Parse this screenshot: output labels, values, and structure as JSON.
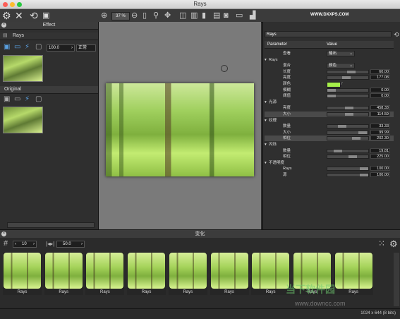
{
  "window": {
    "title": "Rays"
  },
  "toolbar": {
    "zoom": "37 %",
    "brand": "WWW.DXXPS.COM"
  },
  "left_panel": {
    "effect_header": "Effect",
    "effect_name": "Rays",
    "opacity_value": "100.0",
    "blend_mode": "正常",
    "original_header": "Original"
  },
  "right_panel": {
    "name": "Rays",
    "col_parameter": "Parameter",
    "col_value": "Value",
    "rows": [
      {
        "kind": "row",
        "label": "查看",
        "dropdown": "输出"
      },
      {
        "kind": "group",
        "label": "Rays"
      },
      {
        "kind": "row",
        "label": "混合",
        "dropdown": "颜色"
      },
      {
        "kind": "row",
        "label": "长度",
        "value": "60.00",
        "level": 0.6
      },
      {
        "kind": "row",
        "label": "亮度",
        "value": "177.08",
        "level": 0.45
      },
      {
        "kind": "row",
        "label": "颜色",
        "color": "#a6f04a"
      },
      {
        "kind": "row",
        "label": "模糊",
        "value": "0.00",
        "level": 0.0
      },
      {
        "kind": "row",
        "label": "阈值",
        "value": "0.00",
        "level": 0.0
      },
      {
        "kind": "group",
        "label": "光源"
      },
      {
        "kind": "row",
        "label": "亮度",
        "value": "458.33",
        "level": 0.55
      },
      {
        "kind": "row",
        "label": "大小",
        "value": "114.59",
        "level": 0.55,
        "highlight": true
      },
      {
        "kind": "group",
        "label": "纹理"
      },
      {
        "kind": "row",
        "label": "数量",
        "value": "33.33",
        "level": 0.33
      },
      {
        "kind": "row",
        "label": "大小",
        "value": "99.99",
        "level": 0.95
      },
      {
        "kind": "row",
        "label": "相位",
        "value": "202.30",
        "level": 0.75,
        "highlight": true
      },
      {
        "kind": "group",
        "label": "闪烁"
      },
      {
        "kind": "row",
        "label": "数量",
        "value": "19.81",
        "level": 0.2
      },
      {
        "kind": "row",
        "label": "相位",
        "value": "225.00",
        "level": 0.65
      },
      {
        "kind": "group",
        "label": "不透明度"
      },
      {
        "kind": "row",
        "label": "Rays",
        "value": "100.00",
        "level": 1.0
      },
      {
        "kind": "row",
        "label": "源",
        "value": "100.00",
        "level": 1.0
      }
    ]
  },
  "bottom": {
    "header": "变化",
    "count": "10",
    "amount": "50.0",
    "variations": [
      "Rays",
      "Rays",
      "Rays",
      "Rays",
      "Rays",
      "Rays",
      "Rays",
      "Rays",
      "Rays"
    ]
  },
  "status": {
    "text": "1024 x 644 (8 bits)"
  },
  "watermark": {
    "main": "当下软件园",
    "sub": "www.downcc.com"
  }
}
